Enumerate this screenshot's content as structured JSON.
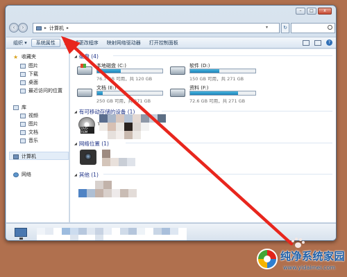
{
  "addressbar": {
    "breadcrumb": [
      "计算机"
    ],
    "nav_arrow": "▸",
    "dropdown_arrow": "▾",
    "refresh_glyph": "↻"
  },
  "toolbar": {
    "organize": "组织 ▾",
    "system_properties": "系统属性",
    "uninstall": "卸载或更改程序",
    "map_drive": "映射网络驱动器",
    "control_panel": "打开控制面板",
    "help_glyph": "?"
  },
  "window_controls": {
    "minimize": "–",
    "maximize": "□",
    "close": "x"
  },
  "sidebar": {
    "favorites": "收藏夹",
    "favorites_items": [
      "图片",
      "下载",
      "桌面",
      "最近访问的位置"
    ],
    "libraries": "库",
    "libraries_items": [
      "视频",
      "图片",
      "文档",
      "音乐"
    ],
    "computer": "计算机",
    "network": "网络"
  },
  "main": {
    "hard_drives_header": "硬盘 (4)",
    "removable_header": "有可移动存储的设备 (1)",
    "network_header": "网络位置 (1)",
    "other_header": "其他 (1)",
    "drives": [
      {
        "name": "本地磁盘 (C:)",
        "info": "76.7 GB 可用，共 120 GB",
        "used": 0.36
      },
      {
        "name": "软件 (D:)",
        "info": "150 GB 可用，共 271 GB",
        "used": 0.45
      },
      {
        "name": "文档 (E:)",
        "info": "250 GB 可用，共 271 GB",
        "used": 0.08
      },
      {
        "name": "资料 (F:)",
        "info": "72.6 GB 可用，共 271 GB",
        "used": 0.73
      }
    ],
    "dvd_label": "DVD-ROM",
    "removable_partial_text": "W"
  },
  "watermark": {
    "site_name": "纯净系统家园",
    "site_url": "www.yidaimei.com"
  },
  "colors": {
    "arrow": "#e8261d",
    "desktop": "#b0704e",
    "drive_fill": "#2a93c9"
  }
}
